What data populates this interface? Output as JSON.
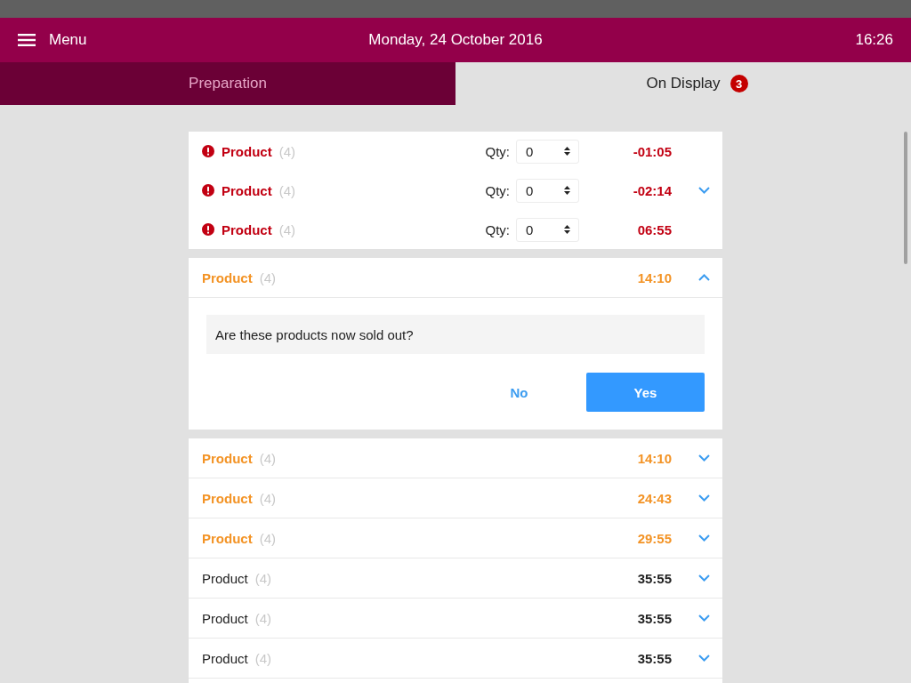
{
  "header": {
    "menu_label": "Menu",
    "date": "Monday, 24 October 2016",
    "time": "16:26"
  },
  "tabs": [
    {
      "label": "Preparation",
      "selected": false
    },
    {
      "label": "On Display",
      "selected": true,
      "badge": "3"
    }
  ],
  "sections": [
    {
      "kind": "batch",
      "expanded": false,
      "items": [
        {
          "alert": true,
          "bold": true,
          "color": "#c20012",
          "name": "Product",
          "count": "(4)",
          "qty_label": "Qty:",
          "qty": "0",
          "time": "-01:05"
        },
        {
          "alert": true,
          "bold": true,
          "color": "#c20012",
          "name": "Product",
          "count": "(4)",
          "qty_label": "Qty:",
          "qty": "0",
          "time": "-02:14"
        },
        {
          "alert": true,
          "bold": true,
          "color": "#c20012",
          "name": "Product",
          "count": "(4)",
          "qty_label": "Qty:",
          "qty": "0",
          "time": "06:55"
        }
      ]
    },
    {
      "kind": "entries",
      "entries": [
        {
          "alert": false,
          "bold": true,
          "color": "#f39325",
          "name": "Product",
          "count": "(4)",
          "time": "14:10",
          "expanded": true,
          "confirm": {
            "question": "Are these products now sold out?",
            "buttons": [
              {
                "label": "No",
                "kind": "secondary"
              },
              {
                "label": "Yes",
                "kind": "primary"
              }
            ]
          }
        }
      ]
    },
    {
      "kind": "entries",
      "entries": [
        {
          "alert": false,
          "bold": true,
          "color": "#f39325",
          "name": "Product",
          "count": "(4)",
          "time": "14:10",
          "expanded": false
        },
        {
          "alert": false,
          "bold": true,
          "color": "#f39325",
          "name": "Product",
          "count": "(4)",
          "time": "24:43",
          "expanded": false
        },
        {
          "alert": false,
          "bold": true,
          "color": "#f39325",
          "name": "Product",
          "count": "(4)",
          "time": "29:55",
          "expanded": false
        },
        {
          "alert": false,
          "bold": false,
          "color": "#222222",
          "name": "Product",
          "count": "(4)",
          "time": "35:55",
          "expanded": false
        },
        {
          "alert": false,
          "bold": false,
          "color": "#222222",
          "name": "Product",
          "count": "(4)",
          "time": "35:55",
          "expanded": false
        },
        {
          "alert": false,
          "bold": false,
          "color": "#222222",
          "name": "Product",
          "count": "(4)",
          "time": "35:55",
          "expanded": false
        }
      ]
    }
  ]
}
